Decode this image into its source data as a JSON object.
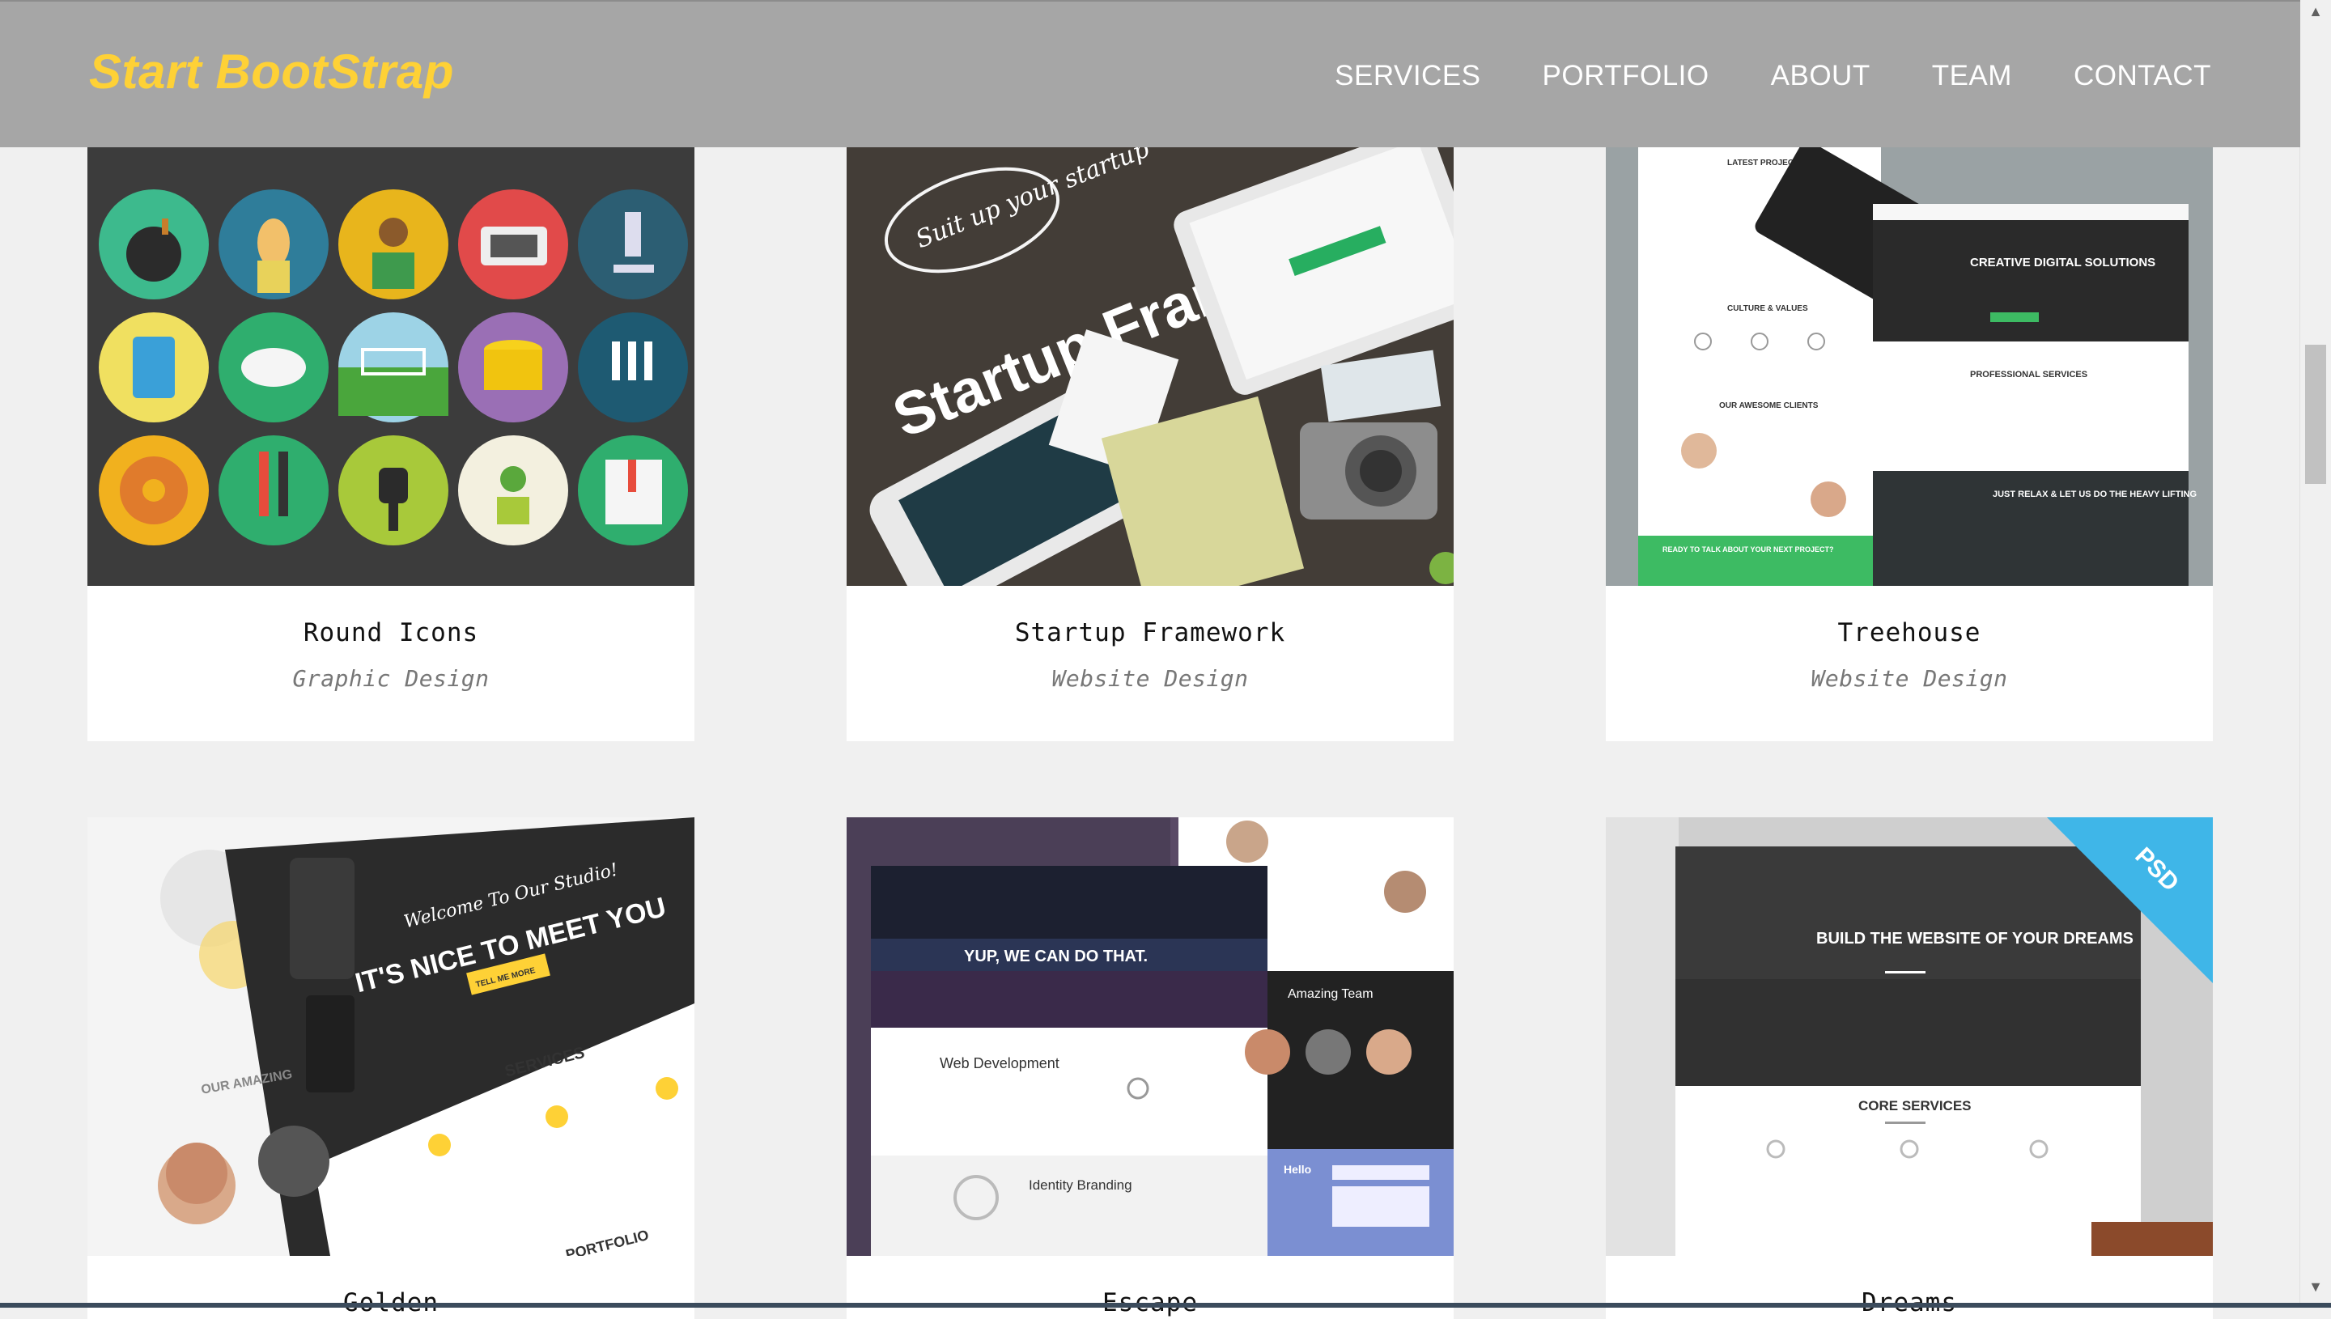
{
  "navbar": {
    "brand": "Start BootStrap",
    "links": [
      "SERVICES",
      "PORTFOLIO",
      "ABOUT",
      "TEAM",
      "CONTACT"
    ]
  },
  "portfolio": {
    "items": [
      {
        "title": "Round Icons",
        "category": "Graphic Design"
      },
      {
        "title": "Startup Framework",
        "category": "Website Design"
      },
      {
        "title": "Treehouse",
        "category": "Website Design"
      },
      {
        "title": "Golden",
        "category": ""
      },
      {
        "title": "Escape",
        "category": ""
      },
      {
        "title": "Dreams",
        "category": ""
      }
    ]
  },
  "thumbs": {
    "startup": {
      "badge": "Suit up your startup",
      "headline": "Startup Framework"
    },
    "treehouse": {
      "latest": "LATEST PROJECT",
      "culture": "CULTURE & VALUES",
      "clients": "OUR AWESOME CLIENTS",
      "cta": "READY TO TALK ABOUT YOUR NEXT PROJECT?",
      "hero": "CREATIVE DIGITAL SOLUTIONS",
      "services": "PROFESSIONAL SERVICES",
      "relax": "JUST RELAX & LET US DO THE HEAVY LIFTING"
    },
    "golden": {
      "welcome": "Welcome To Our Studio!",
      "headline": "IT'S NICE TO MEET YOU",
      "button": "TELL ME MORE",
      "services": "SERVICES",
      "amazing": "OUR AMAZING",
      "portfolio": "PORTFOLIO"
    },
    "escape": {
      "hero": "YUP, WE CAN DO THAT.",
      "web": "Web Development",
      "identity": "Identity Branding",
      "team": "Amazing Team",
      "hello": "Hello"
    },
    "dreams": {
      "ribbon": "PSD",
      "headline": "BUILD THE WEBSITE OF YOUR DREAMS",
      "core": "CORE SERVICES"
    }
  },
  "colors": {
    "navbar": "#a6a6a6",
    "brand": "#fed136",
    "page": "#f0f0f0"
  }
}
